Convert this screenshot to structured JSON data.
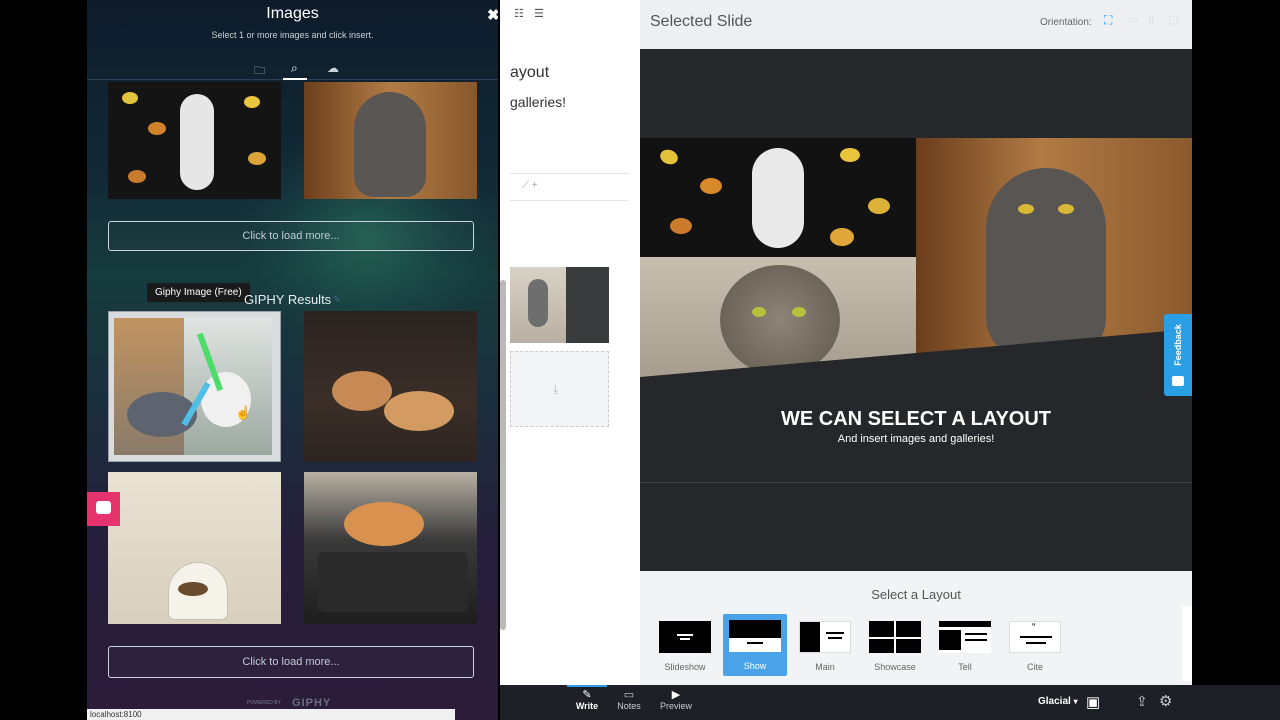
{
  "images_panel": {
    "title": "Images",
    "subtitle": "Select 1 or more images and click insert.",
    "load_more_label": "Click to load more...",
    "giphy_results_title": "GIPHY Results",
    "tooltip": "Giphy Image (Free)",
    "powered_by": "POWERED BY",
    "giphy_logo": "GIPHY",
    "tabs": [
      "folder-icon",
      "search-icon",
      "upload-cloud-icon"
    ]
  },
  "editor_fragment": {
    "line1": "ayout",
    "line2": "galleries!"
  },
  "selected_slide": {
    "title": "Selected Slide",
    "orientation_label": "Orientation:",
    "headline": "WE CAN SELECT A LAYOUT",
    "subheadline": "And insert images and galleries!"
  },
  "layout_picker": {
    "title": "Select a Layout",
    "items": [
      {
        "label": "Slideshow",
        "selected": false
      },
      {
        "label": "Show",
        "selected": true
      },
      {
        "label": "Main",
        "selected": false
      },
      {
        "label": "Showcase",
        "selected": false
      },
      {
        "label": "Tell",
        "selected": false
      },
      {
        "label": "Cite",
        "selected": false
      }
    ]
  },
  "feedback_tab": "Feedback",
  "bottom_bar": {
    "write": "Write",
    "notes": "Notes",
    "preview": "Preview",
    "theme": "Glacial"
  },
  "status_bar": "localhost:8100",
  "colors": {
    "accent": "#2b9fe6",
    "layout_selected": "#4aa3e8",
    "chat_widget": "#e6336e",
    "panel_dark": "#0e1b2b"
  }
}
